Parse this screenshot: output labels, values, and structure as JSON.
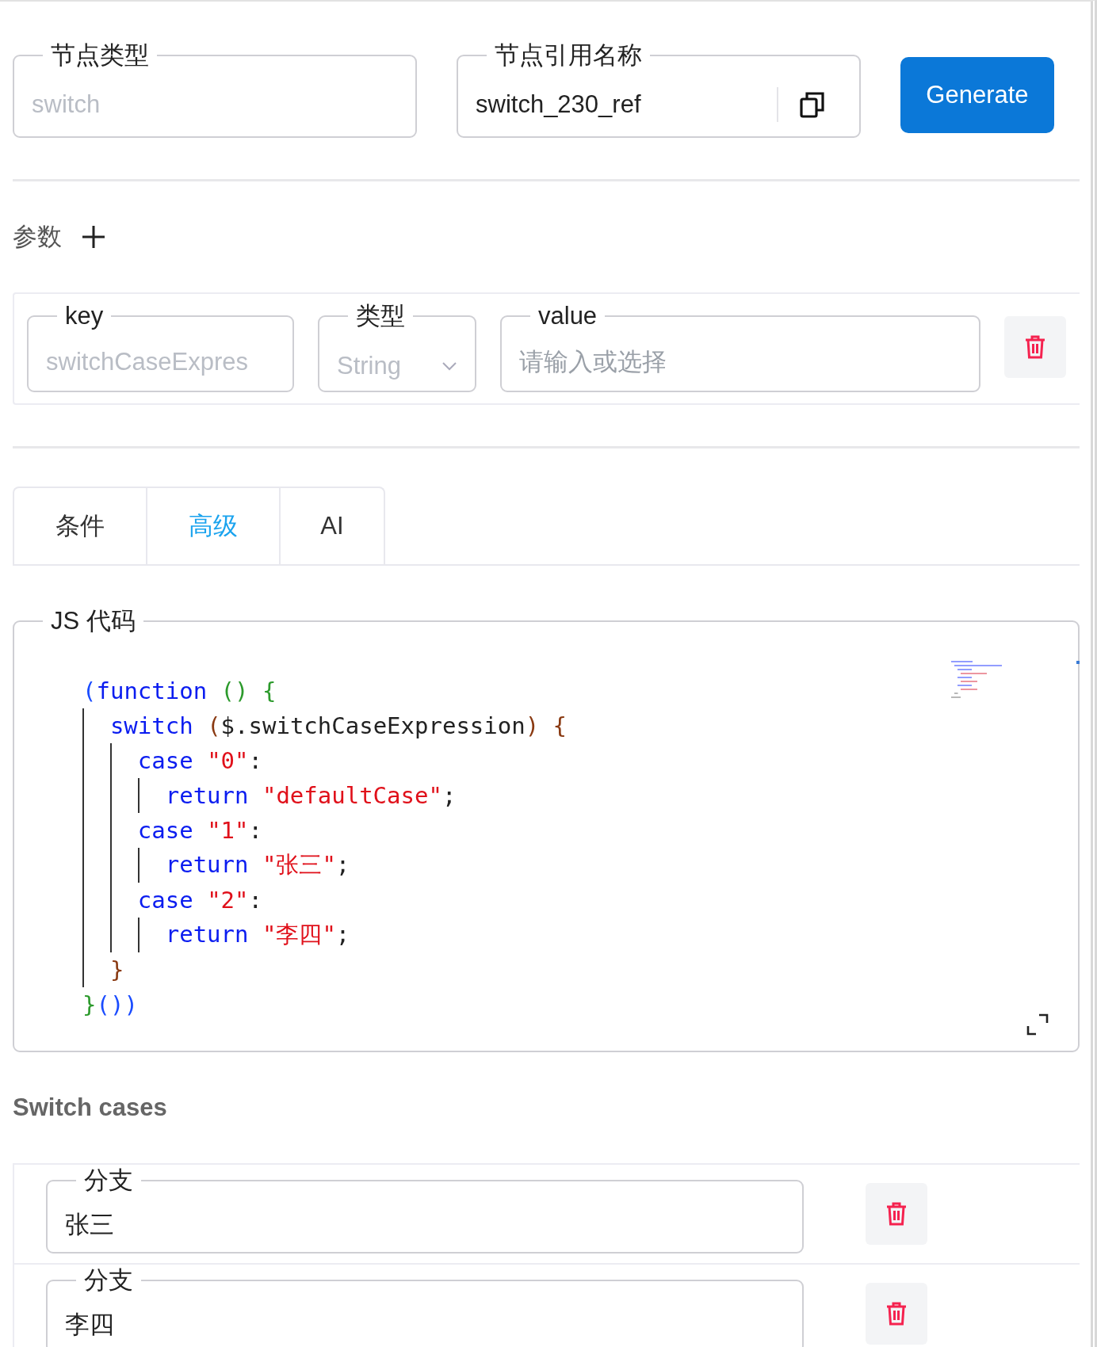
{
  "top": {
    "node_type": {
      "label": "节点类型",
      "value": "switch",
      "disabled": true
    },
    "ref_name": {
      "label": "节点引用名称",
      "value": "switch_230_ref",
      "disabled": false
    },
    "generate_button": "Generate"
  },
  "params": {
    "title": "参数",
    "rows": [
      {
        "key": {
          "label": "key",
          "value": "switchCaseExpres",
          "disabled": true
        },
        "type": {
          "label": "类型",
          "value": "String",
          "disabled": true
        },
        "value": {
          "label": "value",
          "placeholder": "请输入或选择"
        }
      }
    ]
  },
  "tabs": [
    {
      "label": "条件",
      "selected": false
    },
    {
      "label": "高级",
      "selected": true
    },
    {
      "label": "AI",
      "selected": false
    }
  ],
  "code_editor": {
    "label": "JS 代码",
    "lines": [
      [
        {
          "kind": "bracket-a",
          "text": "("
        },
        {
          "kind": "keyword",
          "text": "function "
        },
        {
          "kind": "bracket-b",
          "text": "() {"
        }
      ],
      [
        {
          "kind": "keyword",
          "text": "  switch "
        },
        {
          "kind": "bracket-c",
          "text": "("
        },
        {
          "kind": "plain",
          "text": "$.switchCaseExpression"
        },
        {
          "kind": "bracket-c",
          "text": ") {"
        }
      ],
      [
        {
          "kind": "keyword",
          "text": "    case "
        },
        {
          "kind": "string",
          "text": "\"0\""
        },
        {
          "kind": "plain",
          "text": ":"
        }
      ],
      [
        {
          "kind": "keyword",
          "text": "      return "
        },
        {
          "kind": "string",
          "text": "\"defaultCase\""
        },
        {
          "kind": "plain",
          "text": ";"
        }
      ],
      [
        {
          "kind": "keyword",
          "text": "    case "
        },
        {
          "kind": "string",
          "text": "\"1\""
        },
        {
          "kind": "plain",
          "text": ":"
        }
      ],
      [
        {
          "kind": "keyword",
          "text": "      return "
        },
        {
          "kind": "string",
          "text": "\"张三\""
        },
        {
          "kind": "plain",
          "text": ";"
        }
      ],
      [
        {
          "kind": "keyword",
          "text": "    case "
        },
        {
          "kind": "string",
          "text": "\"2\""
        },
        {
          "kind": "plain",
          "text": ":"
        }
      ],
      [
        {
          "kind": "keyword",
          "text": "      return "
        },
        {
          "kind": "string",
          "text": "\"李四\""
        },
        {
          "kind": "plain",
          "text": ";"
        }
      ],
      [
        {
          "kind": "bracket-c",
          "text": "  }"
        }
      ],
      [
        {
          "kind": "bracket-b",
          "text": "}"
        },
        {
          "kind": "bracket-a",
          "text": "())"
        }
      ]
    ]
  },
  "switch_cases": {
    "title": "Switch cases",
    "cases": [
      {
        "label": "分支",
        "value": "张三"
      },
      {
        "label": "分支",
        "value": "李四"
      }
    ]
  }
}
